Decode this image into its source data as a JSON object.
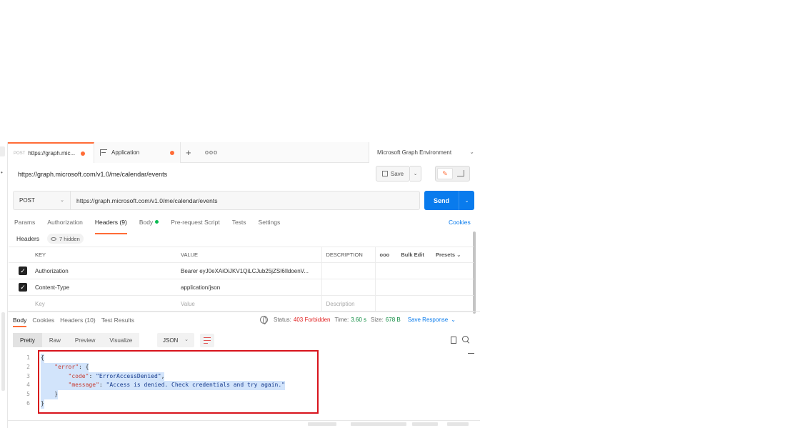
{
  "tabs": [
    {
      "method": "POST",
      "label": "https://graph.mic...",
      "unsaved": true
    },
    {
      "label": "Application",
      "unsaved": true
    }
  ],
  "new_tab": "+",
  "more_tabs": "ooo",
  "environment": "Microsoft Graph Environment",
  "request_name": "https://graph.microsoft.com/v1.0/me/calendar/events",
  "save_label": "Save",
  "method": "POST",
  "url": "https://graph.microsoft.com/v1.0/me/calendar/events",
  "send_label": "Send",
  "request_tabs": [
    "Params",
    "Authorization",
    "Headers (9)",
    "Body",
    "Pre-request Script",
    "Tests",
    "Settings"
  ],
  "cookies_label": "Cookies",
  "headers_sub": {
    "label": "Headers",
    "hidden": "7 hidden"
  },
  "header_table": {
    "columns": [
      "KEY",
      "VALUE",
      "DESCRIPTION"
    ],
    "more": "ooo",
    "bulk_edit": "Bulk Edit",
    "presets": "Presets",
    "rows": [
      {
        "key": "Authorization",
        "value": "Bearer eyJ0eXAiOiJKV1QiLCJub25jZSI6IldoenV...",
        "checked": true
      },
      {
        "key": "Content-Type",
        "value": "application/json",
        "checked": true
      }
    ],
    "placeholder": {
      "key": "Key",
      "value": "Value",
      "description": "Description"
    }
  },
  "response_tabs": [
    "Body",
    "Cookies",
    "Headers (10)",
    "Test Results"
  ],
  "response_meta": {
    "status_label": "Status:",
    "status": "403 Forbidden",
    "time_label": "Time:",
    "time": "3.60 s",
    "size_label": "Size:",
    "size": "678 B",
    "save_response": "Save Response"
  },
  "format_buttons": [
    "Pretty",
    "Raw",
    "Preview",
    "Visualize"
  ],
  "language": "JSON",
  "code_lines": [
    {
      "n": "1",
      "parts": [
        [
          "p",
          "{"
        ]
      ]
    },
    {
      "n": "2",
      "parts": [
        [
          "p",
          "    "
        ],
        [
          "k",
          "\"error\""
        ],
        [
          "p",
          ": {"
        ]
      ]
    },
    {
      "n": "3",
      "parts": [
        [
          "p",
          "        "
        ],
        [
          "k",
          "\"code\""
        ],
        [
          "p",
          ": "
        ],
        [
          "s",
          "\"ErrorAccessDenied\""
        ],
        [
          "p",
          ","
        ]
      ]
    },
    {
      "n": "4",
      "parts": [
        [
          "p",
          "        "
        ],
        [
          "k",
          "\"message\""
        ],
        [
          "p",
          ": "
        ],
        [
          "s",
          "\"Access is denied. Check credentials and try again.\""
        ]
      ]
    },
    {
      "n": "5",
      "parts": [
        [
          "p",
          "    }"
        ]
      ]
    },
    {
      "n": "6",
      "parts": [
        [
          "p",
          "}"
        ]
      ]
    }
  ],
  "colors": {
    "accent": "#ff6c37",
    "primary": "#097bed",
    "error": "#e01f1f",
    "success": "#0b8a3e",
    "highlight_box": "#d8131c"
  }
}
